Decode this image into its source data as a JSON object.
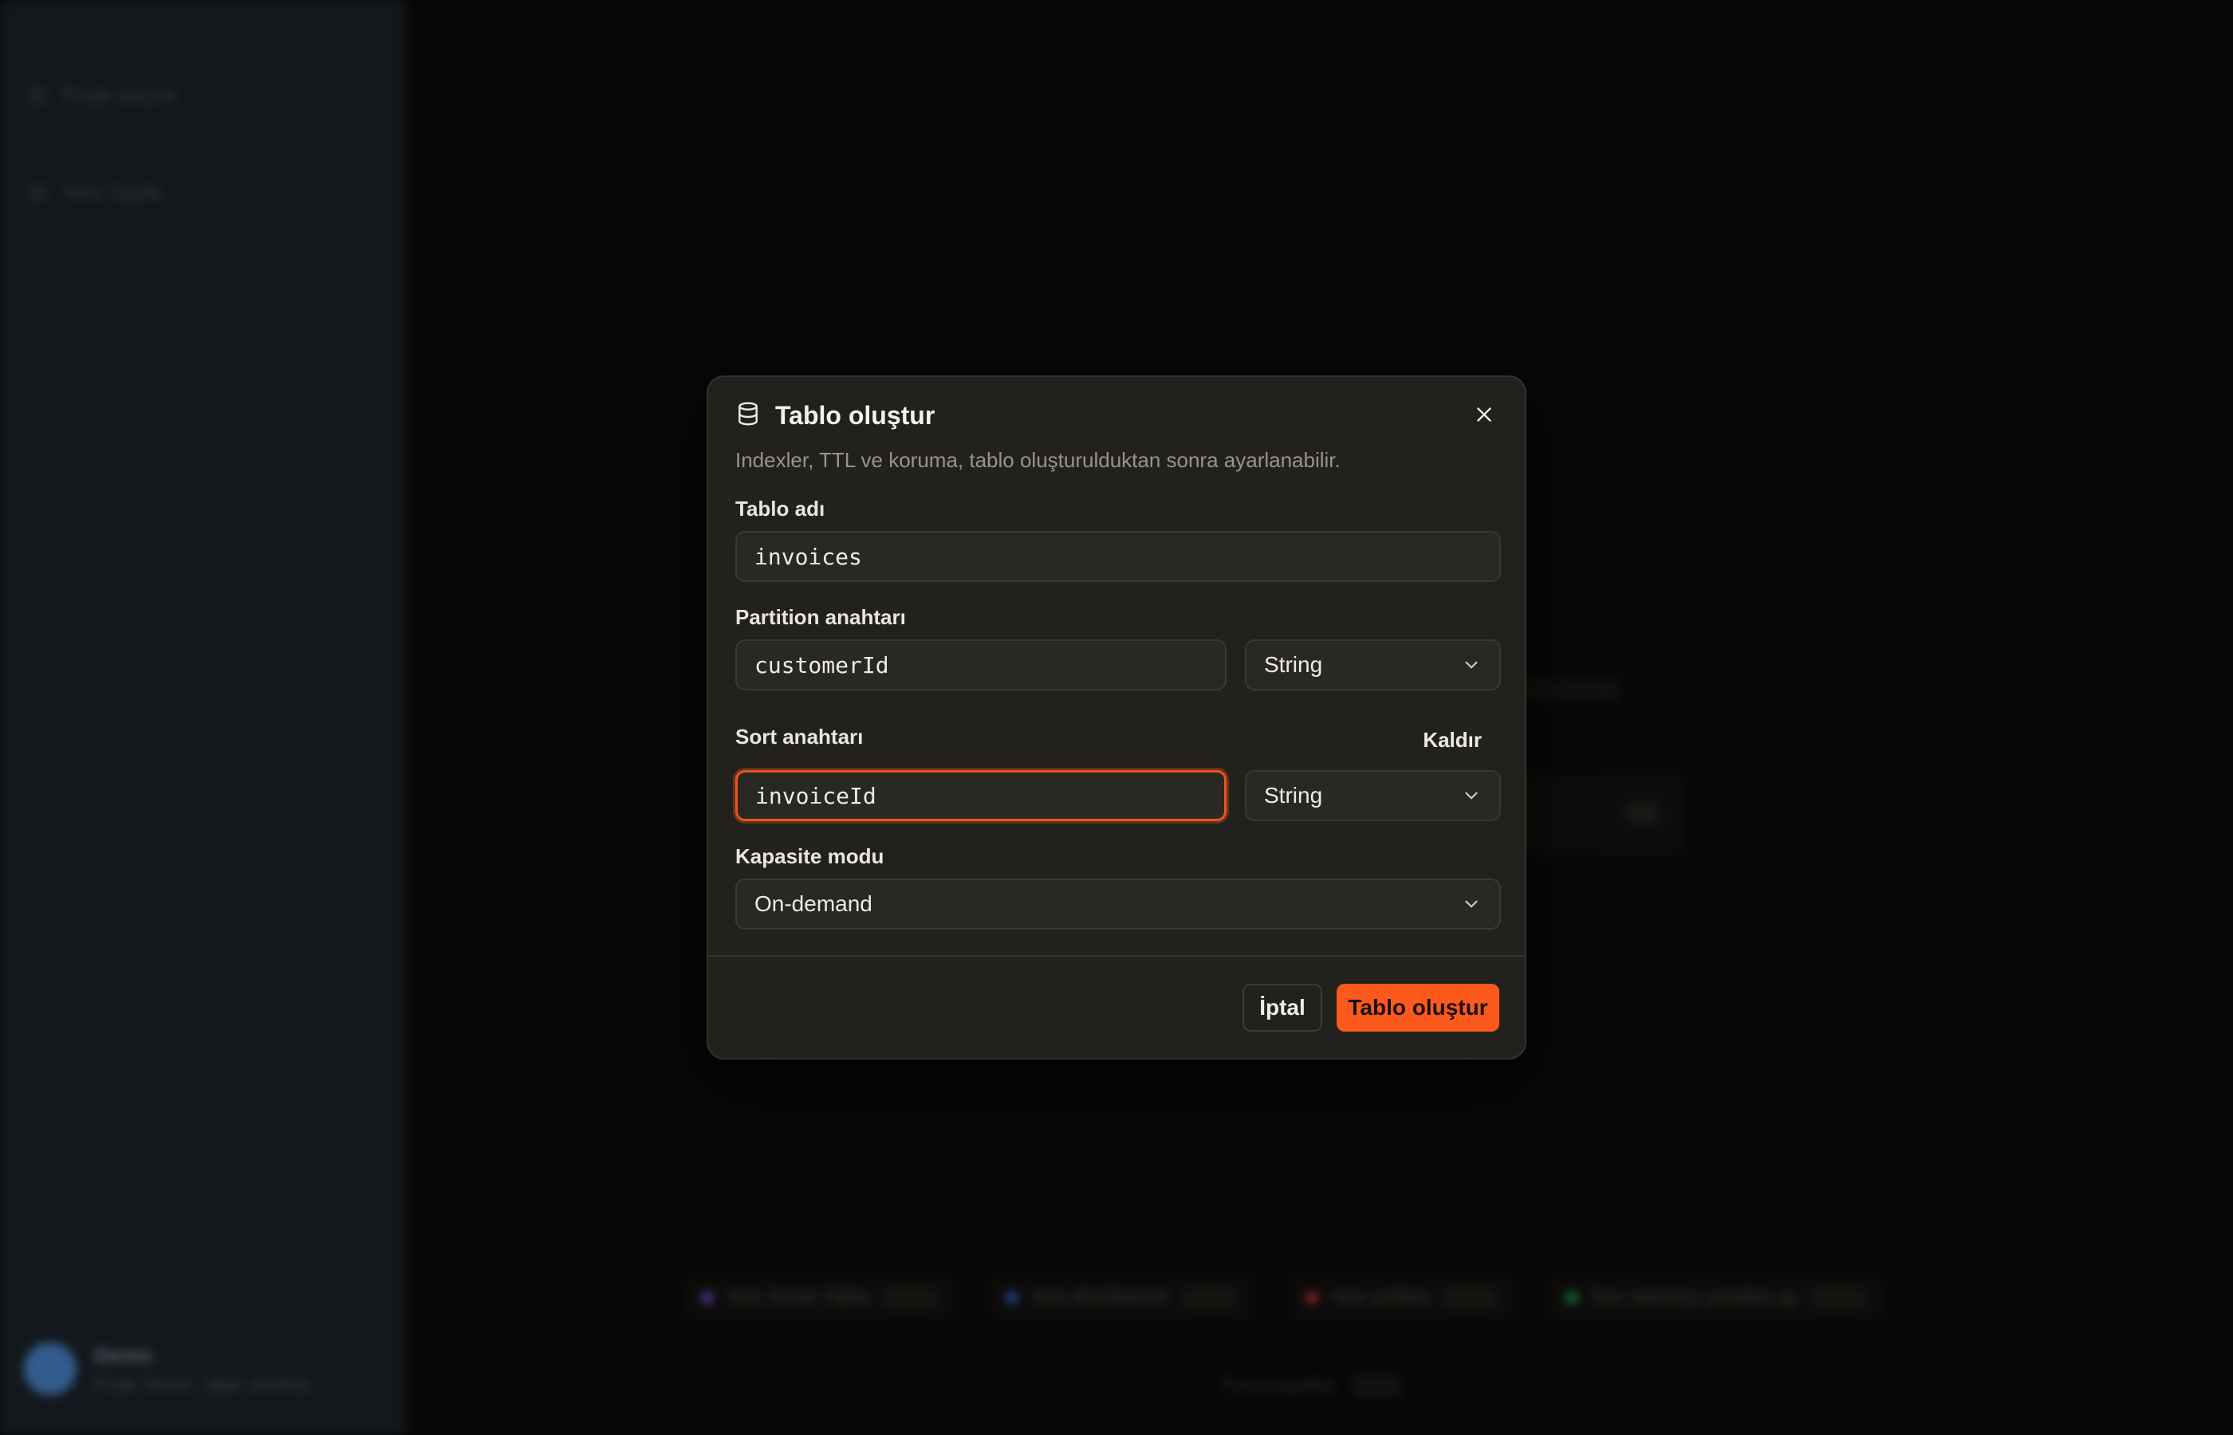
{
  "background": {
    "sidebar_items": [
      "Proje seçimi",
      "Yeni Sayfa"
    ],
    "user": {
      "name": "Demo",
      "sub": "Proje: Demo · plan: ücretsiz"
    },
    "chips": [
      {
        "label": "Yeni Smart Table",
        "color": "#8b5cf6"
      },
      {
        "label": "Yeni Workbench",
        "color": "#3b82f6"
      },
      {
        "label": "Yeni sohbet",
        "color": "#ef4444"
      },
      {
        "label": "Son sekmeyi yeniden aç",
        "color": "#22c55e"
      }
    ],
    "footer": "Tüm kısayollar"
  },
  "modal": {
    "title": "Tablo oluştur",
    "subtitle": "Indexler, TTL ve koruma, tablo oluşturulduktan sonra ayarlanabilir.",
    "table_name": {
      "label": "Tablo adı",
      "value": "invoices"
    },
    "partition_key": {
      "label": "Partition anahtarı",
      "value": "customerId",
      "type": "String"
    },
    "sort_key": {
      "label": "Sort anahtarı",
      "value": "invoiceId",
      "type": "String",
      "remove_label": "Kaldır"
    },
    "capacity": {
      "label": "Kapasite modu",
      "value": "On-demand"
    },
    "cancel_label": "İptal",
    "submit_label": "Tablo oluştur"
  },
  "colors": {
    "accent": "#fc5a1c",
    "focus_ring": "#e9541e"
  }
}
